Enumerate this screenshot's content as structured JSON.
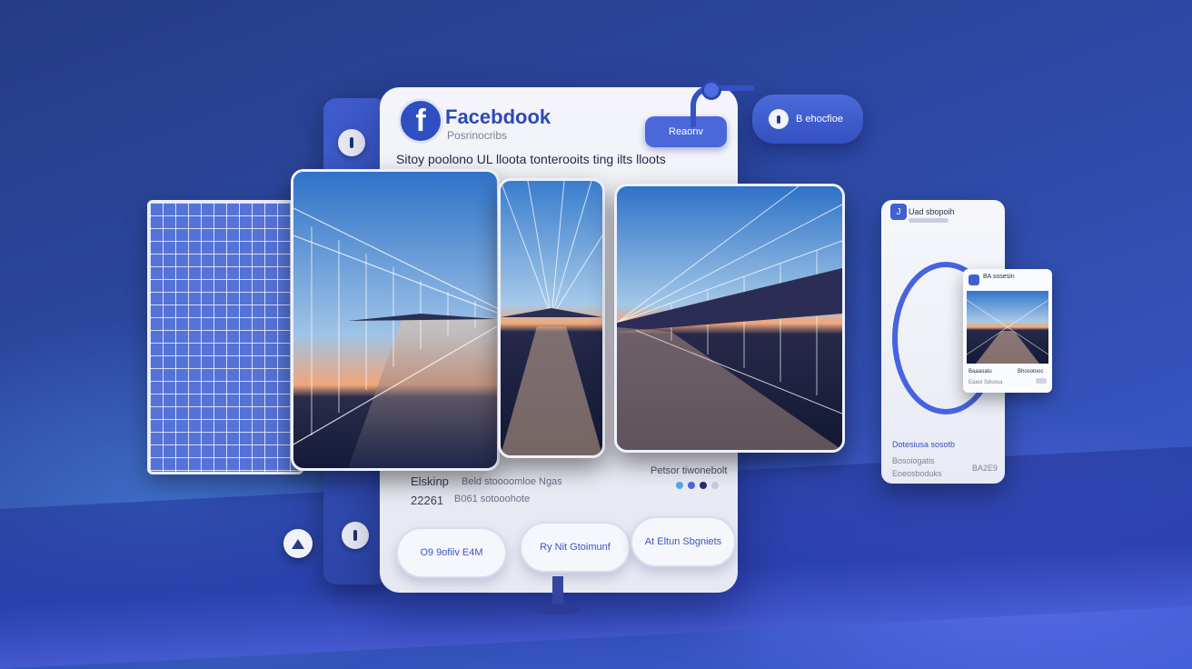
{
  "header": {
    "logo_letter": "f",
    "brand": "Facebdook",
    "subtitle": "Posrinocribs",
    "button": "Reaonv",
    "headline": "Sitoy poolono UL lloota tonterooits ting ilts lloots"
  },
  "floating_chip": {
    "label": "B ehocfioe"
  },
  "stats": {
    "left_big_1": "Elskinp",
    "left_small_1": "Beld stoooomloe Ngas",
    "left_big_2": "22261",
    "left_small_2": "B061 sotooohote",
    "right_title": "Petsor tiwonebolt"
  },
  "carousel_dots": [
    "#5aa9e6",
    "#4a67d6",
    "#23306c",
    "#c7cbdb"
  ],
  "actions": [
    "O9 9ofiiv E4M",
    "Ry Nit Gtoimunf",
    "At Eltun Sbgniets"
  ],
  "side_card": {
    "icon_letter": "J",
    "title": "Uad sbopoih",
    "line1": "Dotesiusa sosotb",
    "line2": "Bosoiogatis",
    "line3": "Eoeosboduks",
    "line4": "BA2E9"
  },
  "mini_card": {
    "title": "BA sosesin",
    "t1": "Baaaoatu",
    "t2": "Bhosotooc",
    "t3": "Eaaoi Sdoosa"
  },
  "colors": {
    "accent": "#4a68da",
    "brand_text": "#2d49b6",
    "background": "#2e4aa6"
  }
}
